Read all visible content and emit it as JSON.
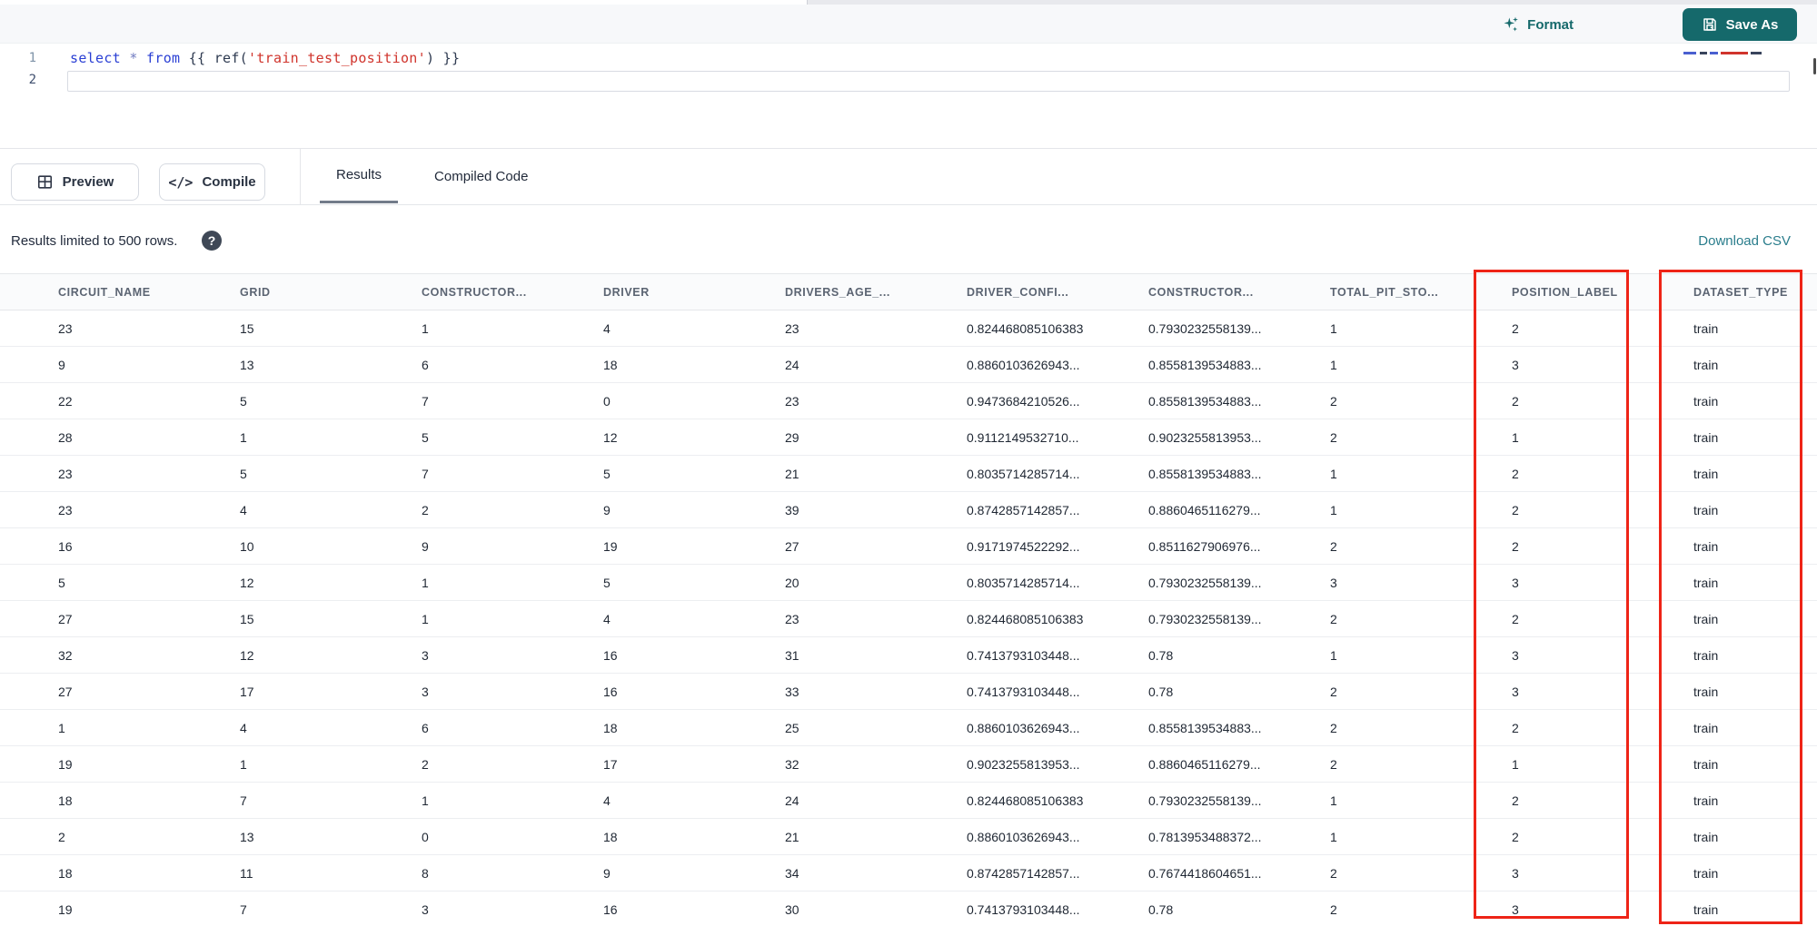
{
  "colors": {
    "accent_teal": "#15696b",
    "link_teal": "#2a7d8c",
    "annotation_red": "#ee2417",
    "keyword_blue": "#2a3fd4",
    "string_red": "#d0342c"
  },
  "toolbar": {
    "format_label": "Format",
    "save_as_label": "Save As"
  },
  "editor": {
    "line_numbers": [
      "1",
      "2"
    ],
    "code_tokens": [
      {
        "text": "select",
        "type": "keyword"
      },
      {
        "text": " ",
        "type": "plain"
      },
      {
        "text": "*",
        "type": "star"
      },
      {
        "text": " ",
        "type": "plain"
      },
      {
        "text": "from",
        "type": "keyword"
      },
      {
        "text": " {{ ",
        "type": "plain"
      },
      {
        "text": "ref(",
        "type": "plain"
      },
      {
        "text": "'train_test_position'",
        "type": "string"
      },
      {
        "text": ") }}",
        "type": "plain"
      }
    ]
  },
  "actions": {
    "preview_label": "Preview",
    "compile_label": "Compile"
  },
  "tabs": [
    {
      "label": "Results",
      "active": true
    },
    {
      "label": "Compiled Code",
      "active": false
    }
  ],
  "results_bar": {
    "info_text": "Results limited to 500 rows.",
    "help_icon": "question-mark-icon",
    "download_label": "Download CSV"
  },
  "table": {
    "columns": [
      "CIRCUIT_NAME",
      "GRID",
      "CONSTRUCTOR...",
      "DRIVER",
      "DRIVERS_AGE_...",
      "DRIVER_CONFI...",
      "CONSTRUCTOR...",
      "TOTAL_PIT_STO...",
      "POSITION_LABEL",
      "DATASET_TYPE"
    ],
    "highlighted_columns": [
      "POSITION_LABEL",
      "DATASET_TYPE"
    ],
    "rows": [
      [
        "23",
        "15",
        "1",
        "4",
        "23",
        "0.824468085106383",
        "0.7930232558139...",
        "1",
        "2",
        "train"
      ],
      [
        "9",
        "13",
        "6",
        "18",
        "24",
        "0.8860103626943...",
        "0.8558139534883...",
        "1",
        "3",
        "train"
      ],
      [
        "22",
        "5",
        "7",
        "0",
        "23",
        "0.9473684210526...",
        "0.8558139534883...",
        "2",
        "2",
        "train"
      ],
      [
        "28",
        "1",
        "5",
        "12",
        "29",
        "0.9112149532710...",
        "0.9023255813953...",
        "2",
        "1",
        "train"
      ],
      [
        "23",
        "5",
        "7",
        "5",
        "21",
        "0.8035714285714...",
        "0.8558139534883...",
        "1",
        "2",
        "train"
      ],
      [
        "23",
        "4",
        "2",
        "9",
        "39",
        "0.8742857142857...",
        "0.8860465116279...",
        "1",
        "2",
        "train"
      ],
      [
        "16",
        "10",
        "9",
        "19",
        "27",
        "0.9171974522292...",
        "0.8511627906976...",
        "2",
        "2",
        "train"
      ],
      [
        "5",
        "12",
        "1",
        "5",
        "20",
        "0.8035714285714...",
        "0.7930232558139...",
        "3",
        "3",
        "train"
      ],
      [
        "27",
        "15",
        "1",
        "4",
        "23",
        "0.824468085106383",
        "0.7930232558139...",
        "2",
        "2",
        "train"
      ],
      [
        "32",
        "12",
        "3",
        "16",
        "31",
        "0.7413793103448...",
        "0.78",
        "1",
        "3",
        "train"
      ],
      [
        "27",
        "17",
        "3",
        "16",
        "33",
        "0.7413793103448...",
        "0.78",
        "2",
        "3",
        "train"
      ],
      [
        "1",
        "4",
        "6",
        "18",
        "25",
        "0.8860103626943...",
        "0.8558139534883...",
        "2",
        "2",
        "train"
      ],
      [
        "19",
        "1",
        "2",
        "17",
        "32",
        "0.9023255813953...",
        "0.8860465116279...",
        "2",
        "1",
        "train"
      ],
      [
        "18",
        "7",
        "1",
        "4",
        "24",
        "0.824468085106383",
        "0.7930232558139...",
        "1",
        "2",
        "train"
      ],
      [
        "2",
        "13",
        "0",
        "18",
        "21",
        "0.8860103626943...",
        "0.7813953488372...",
        "1",
        "2",
        "train"
      ],
      [
        "18",
        "11",
        "8",
        "9",
        "34",
        "0.8742857142857...",
        "0.7674418604651...",
        "2",
        "3",
        "train"
      ],
      [
        "19",
        "7",
        "3",
        "16",
        "30",
        "0.7413793103448...",
        "0.78",
        "2",
        "3",
        "train"
      ]
    ]
  }
}
